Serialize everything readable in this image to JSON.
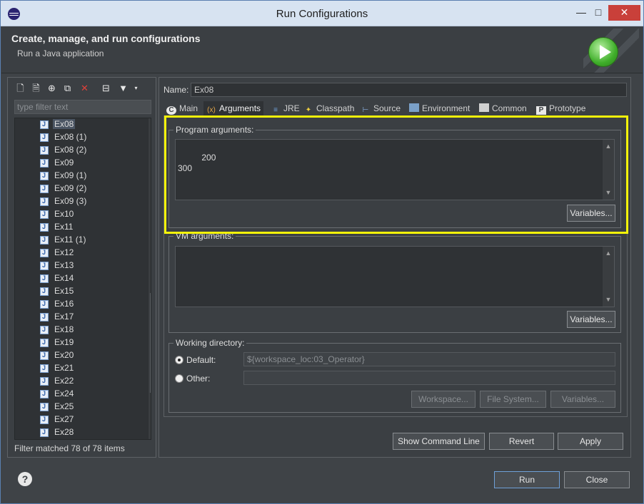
{
  "window": {
    "title": "Run Configurations",
    "min_glyph": "—",
    "max_glyph": "□",
    "close_glyph": "✕"
  },
  "header": {
    "title": "Create, manage, and run configurations",
    "subtitle": "Run a Java application"
  },
  "left": {
    "filter_placeholder": "type filter text",
    "items": [
      "Ex08",
      "Ex08 (1)",
      "Ex08 (2)",
      "Ex09",
      "Ex09 (1)",
      "Ex09 (2)",
      "Ex09 (3)",
      "Ex10",
      "Ex11",
      "Ex11 (1)",
      "Ex12",
      "Ex13",
      "Ex14",
      "Ex15",
      "Ex16",
      "Ex17",
      "Ex18",
      "Ex19",
      "Ex20",
      "Ex21",
      "Ex22",
      "Ex24",
      "Ex25",
      "Ex27",
      "Ex28"
    ],
    "status": "Filter matched 78 of 78 items"
  },
  "right": {
    "name_label": "Name:",
    "name_value": "Ex08",
    "tabs": [
      {
        "label": "Main",
        "icon": "main-tab-icon"
      },
      {
        "label": "Arguments",
        "icon": "arguments-tab-icon"
      },
      {
        "label": "JRE",
        "icon": "jre-tab-icon"
      },
      {
        "label": "Classpath",
        "icon": "classpath-tab-icon"
      },
      {
        "label": "Source",
        "icon": "source-tab-icon"
      },
      {
        "label": "Environment",
        "icon": "environment-tab-icon"
      },
      {
        "label": "Common",
        "icon": "common-tab-icon"
      },
      {
        "label": "Prototype",
        "icon": "prototype-tab-icon"
      }
    ],
    "program_args": {
      "title": "Program arguments:",
      "value": "200\n300",
      "variables_button": "Variables..."
    },
    "vm_args": {
      "title": "VM arguments:",
      "value": "",
      "variables_button": "Variables..."
    },
    "working_dir": {
      "title": "Working directory:",
      "default_label": "Default:",
      "default_value": "${workspace_loc:03_Operator}",
      "other_label": "Other:",
      "other_value": "",
      "workspace_button": "Workspace...",
      "filesystem_button": "File System...",
      "variables_button": "Variables..."
    },
    "show_command_line": "Show Command Line",
    "revert": "Revert",
    "apply": "Apply"
  },
  "footer": {
    "run": "Run",
    "close": "Close",
    "help_glyph": "?"
  },
  "colors": {
    "highlight": "#f4f30a",
    "background": "#3b3f43",
    "close_button": "#c9403a"
  }
}
